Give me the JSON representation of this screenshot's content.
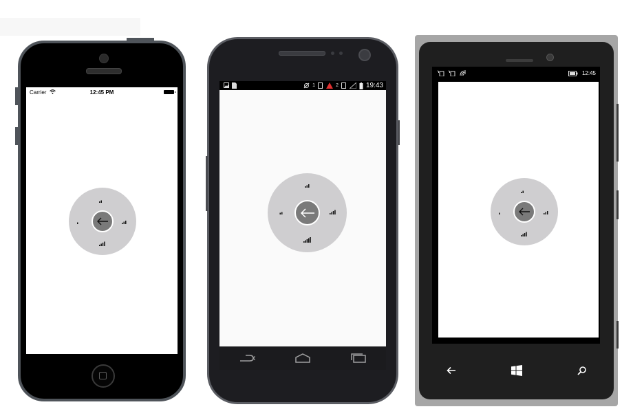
{
  "ios": {
    "carrier": "Carrier",
    "time": "12:45 PM",
    "icons": {
      "wifi": "wifi-icon",
      "battery": "battery-icon",
      "home": "home-button-icon"
    }
  },
  "android": {
    "time": "19:43",
    "notif_counts": [
      "1",
      "2"
    ],
    "nav_icons": [
      "back-icon",
      "home-icon",
      "recents-icon"
    ]
  },
  "winphone": {
    "time": "12:45",
    "nav_icons": [
      "back-arrow-icon",
      "windows-logo-icon",
      "search-icon"
    ]
  },
  "radial_menu": {
    "center_icon": "back-arrow-icon",
    "items": [
      {
        "position": "top",
        "icon": "signal-bars-icon",
        "level": 2
      },
      {
        "position": "right",
        "icon": "signal-bars-icon",
        "level": 3
      },
      {
        "position": "bottom",
        "icon": "signal-bars-icon",
        "level": 4
      },
      {
        "position": "left",
        "icon": "signal-bars-icon",
        "level": 1
      }
    ]
  },
  "colors": {
    "radial_bg": "#cfced0",
    "radial_center": "#7a7a7a",
    "iphone_bezel": "#4f545a",
    "android_body": "#1d1d21",
    "winphone_frame": "#a6a6a6"
  }
}
